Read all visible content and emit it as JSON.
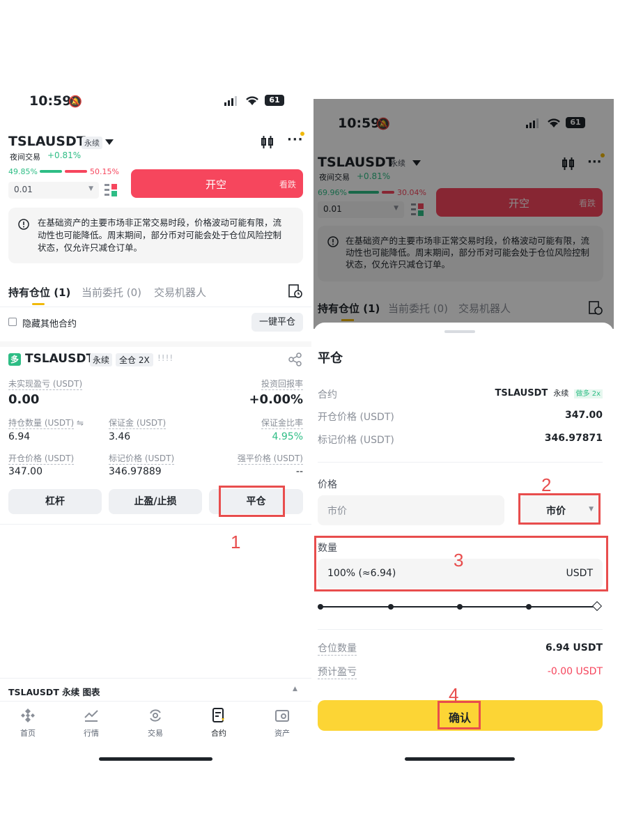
{
  "left": {
    "status": {
      "time": "10:59",
      "battery": "61"
    },
    "symbol": "TSLAUSDT",
    "perp_tag": "永续",
    "session": "夜间交易",
    "change": "+0.81%",
    "ratio_buy": "49.85%",
    "ratio_sell": "50.15%",
    "ratio_buy_fraction": 0.4985,
    "qty_value": "0.01",
    "open_short_label": "开空",
    "bear_label": "看跌",
    "notice": "在基础资产的主要市场非正常交易时段，价格波动可能有限，流动性也可能降低。周末期间，部分币对可能会处于仓位风险控制状态，仅允许只减仓订单。",
    "tabs": [
      "持有仓位 (1)",
      "当前委托 (0)",
      "交易机器人"
    ],
    "hide_other": "隐藏其他合约",
    "close_all": "一键平仓",
    "position": {
      "side": "多",
      "symbol": "TSLAUSDT",
      "perp": "永续",
      "mode": "全仓 2X",
      "pnl_label": "未实现盈亏 (USDT)",
      "pnl_value": "0.00",
      "roi_label": "投资回报率",
      "roi_value": "+0.00%",
      "size_label": "持仓数量 (USDT)",
      "size_value": "6.94",
      "margin_label": "保证金 (USDT)",
      "margin_value": "3.46",
      "margin_ratio_label": "保证金比率",
      "margin_ratio_value": "4.95%",
      "entry_label": "开仓价格 (USDT)",
      "entry_value": "347.00",
      "mark_label": "标记价格 (USDT)",
      "mark_value": "346.97889",
      "liq_label": "强平价格 (USDT)",
      "liq_value": "--"
    },
    "actions": [
      "杠杆",
      "止盈/止损",
      "平仓"
    ],
    "chart_bar": "TSLAUSDT 永续 图表",
    "nav": [
      "首页",
      "行情",
      "交易",
      "合约",
      "资产"
    ]
  },
  "right": {
    "status": {
      "time": "10:59",
      "battery": "61"
    },
    "symbol": "TSLAUSDT",
    "perp_tag": "永续",
    "session": "夜间交易",
    "change": "+0.81%",
    "ratio_buy": "69.96%",
    "ratio_sell": "30.04%",
    "ratio_buy_fraction": 0.6996,
    "qty_value": "0.01",
    "open_short_label": "开空",
    "bear_label": "看跌",
    "notice": "在基础资产的主要市场非正常交易时段，价格波动可能有限，流动性也可能降低。周末期间，部分币对可能会处于仓位风险控制状态，仅允许只减仓订单。",
    "tabs": [
      "持有仓位 (1)",
      "当前委托 (0)",
      "交易机器人"
    ],
    "sheet": {
      "title": "平仓",
      "contract_label": "合约",
      "contract_value": "TSLAUSDT",
      "contract_perp": "永续",
      "contract_side": "做多 2x",
      "entry_label": "开仓价格 (USDT)",
      "entry_value": "347.00",
      "mark_label": "标记价格 (USDT)",
      "mark_value": "346.97871",
      "price_label": "价格",
      "price_placeholder": "市价",
      "order_type": "市价",
      "qty_label": "数量",
      "qty_value": "100% (≈6.94)",
      "qty_unit": "USDT",
      "slider_percent": 100,
      "pos_label": "仓位数量",
      "pos_value": "6.94 USDT",
      "est_label": "预计盈亏",
      "est_value": "-0.00 USDT",
      "confirm": "确认"
    }
  },
  "annotations": [
    "1",
    "2",
    "3",
    "4"
  ],
  "colors": {
    "green": "#2ebd85",
    "red": "#f6465d",
    "yellow": "#fcd535",
    "annotation": "#e84d4d"
  }
}
